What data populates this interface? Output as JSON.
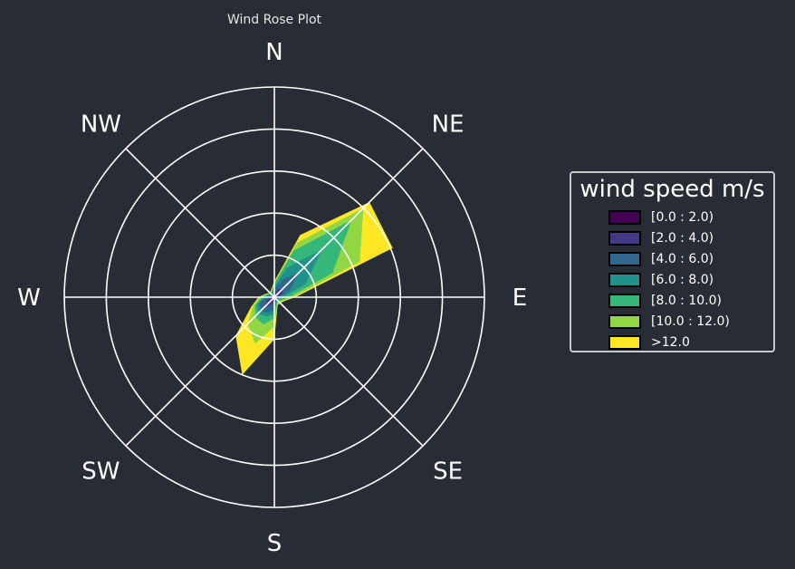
{
  "chart_data": {
    "type": "wind-rose",
    "title": "Wind Rose Plot",
    "directions": [
      "N",
      "NE",
      "E",
      "SE",
      "S",
      "SW",
      "W",
      "NW"
    ],
    "sector_angles_deg": [
      0,
      22.5,
      45,
      67.5,
      90,
      112.5,
      135,
      157.5,
      180,
      202.5,
      225,
      247.5,
      270,
      292.5,
      315,
      337.5
    ],
    "radial_max": 5,
    "radial_rings": [
      1,
      2,
      3,
      4,
      5
    ],
    "radial_labels_shown": false,
    "grid": true,
    "legend": {
      "title": "wind speed m/s",
      "placement": "right"
    },
    "series": [
      {
        "name": "[0.0 : 2.0)",
        "color": "#440154",
        "values": [
          0.02,
          0.03,
          0.05,
          0.05,
          0.03,
          0.02,
          0.02,
          0.02,
          0.02,
          0.02,
          0.05,
          0.03,
          0.02,
          0.02,
          0.02,
          0.02
        ]
      },
      {
        "name": "[2.0 : 4.0)",
        "color": "#443983",
        "values": [
          0.1,
          0.2,
          0.3,
          0.2,
          0.05,
          0.03,
          0.03,
          0.05,
          0.1,
          0.2,
          0.35,
          0.2,
          0.1,
          0.05,
          0.05,
          0.05
        ]
      },
      {
        "name": "[4.0 : 6.0)",
        "color": "#31688e",
        "values": [
          0.18,
          0.45,
          0.8,
          0.4,
          0.12,
          0.06,
          0.06,
          0.1,
          0.3,
          0.4,
          0.45,
          0.4,
          0.18,
          0.1,
          0.08,
          0.08
        ]
      },
      {
        "name": "[6.0 : 8.0)",
        "color": "#21918c",
        "values": [
          0.25,
          0.75,
          1.6,
          0.8,
          0.2,
          0.1,
          0.1,
          0.12,
          0.4,
          0.5,
          0.55,
          0.45,
          0.25,
          0.15,
          0.1,
          0.12
        ]
      },
      {
        "name": "[8.0 : 10.0)",
        "color": "#35b779",
        "values": [
          0.32,
          1.2,
          2.6,
          1.5,
          0.35,
          0.18,
          0.15,
          0.15,
          0.5,
          0.7,
          0.65,
          0.5,
          0.3,
          0.18,
          0.12,
          0.15
        ]
      },
      {
        "name": "[10.0 : 12.0)",
        "color": "#90d743",
        "values": [
          0.35,
          1.4,
          3.0,
          2.2,
          0.45,
          0.22,
          0.18,
          0.18,
          0.7,
          1.2,
          0.9,
          0.55,
          0.35,
          0.2,
          0.14,
          0.18
        ]
      },
      {
        "name": ">12.0",
        "color": "#fde725",
        "values": [
          0.38,
          1.6,
          3.2,
          3.05,
          0.5,
          0.25,
          0.2,
          0.2,
          1.0,
          2.0,
          1.3,
          0.6,
          0.38,
          0.22,
          0.15,
          0.2
        ]
      }
    ]
  }
}
